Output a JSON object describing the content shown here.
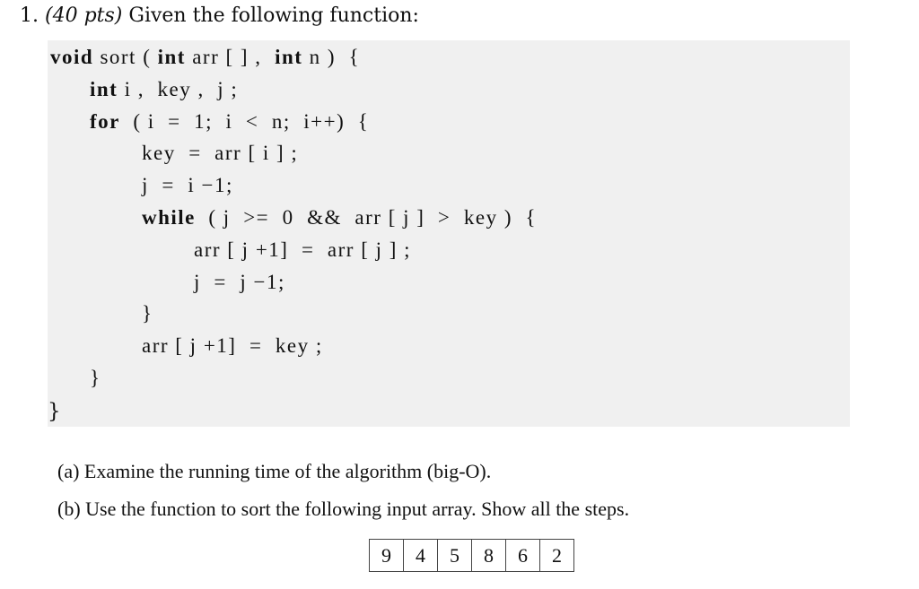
{
  "question": {
    "number": "1.",
    "points": "(40 pts)",
    "prompt": "Given the following function:"
  },
  "code": {
    "lines": [
      {
        "indent": 0,
        "parts": [
          {
            "t": "void",
            "kw": true
          },
          {
            "t": " sort ( "
          },
          {
            "t": "int",
            "kw": true
          },
          {
            "t": " arr [ ] ,  "
          },
          {
            "t": "int",
            "kw": true
          },
          {
            "t": " n )  {"
          }
        ]
      },
      {
        "indent": 1,
        "parts": [
          {
            "t": "int",
            "kw": true
          },
          {
            "t": " i ,  key ,  j ;"
          }
        ]
      },
      {
        "indent": 1,
        "parts": [
          {
            "t": "for",
            "kw": true
          },
          {
            "t": "  ( i  =  1;  i  <  n;  i++)  {"
          }
        ]
      },
      {
        "indent": 2,
        "parts": [
          {
            "t": "key  =  arr [ i ] ;"
          }
        ]
      },
      {
        "indent": 2,
        "parts": [
          {
            "t": "j  =  i −1;"
          }
        ]
      },
      {
        "indent": 2,
        "parts": [
          {
            "t": "while",
            "kw": true
          },
          {
            "t": "  ( j  >=  0  &&  arr [ j ]  >  key )  {"
          }
        ]
      },
      {
        "indent": 3,
        "parts": [
          {
            "t": "arr [ j +1]  =  arr [ j ] ;"
          }
        ]
      },
      {
        "indent": 3,
        "parts": [
          {
            "t": "j  =  j −1;"
          }
        ]
      },
      {
        "indent": 2,
        "parts": [
          {
            "t": "}"
          }
        ]
      },
      {
        "indent": 2,
        "parts": [
          {
            "t": "arr [ j +1]  =  key ;"
          }
        ]
      },
      {
        "indent": 1,
        "parts": [
          {
            "t": "}"
          }
        ]
      }
    ],
    "closing": "}"
  },
  "parts": {
    "a": {
      "label": "(a)",
      "text": "Examine the running time of the algorithm (big-O)."
    },
    "b": {
      "label": "(b)",
      "text": "Use the function to sort the following input array. Show all the steps."
    }
  },
  "input_array": [
    "9",
    "4",
    "5",
    "8",
    "6",
    "2"
  ]
}
